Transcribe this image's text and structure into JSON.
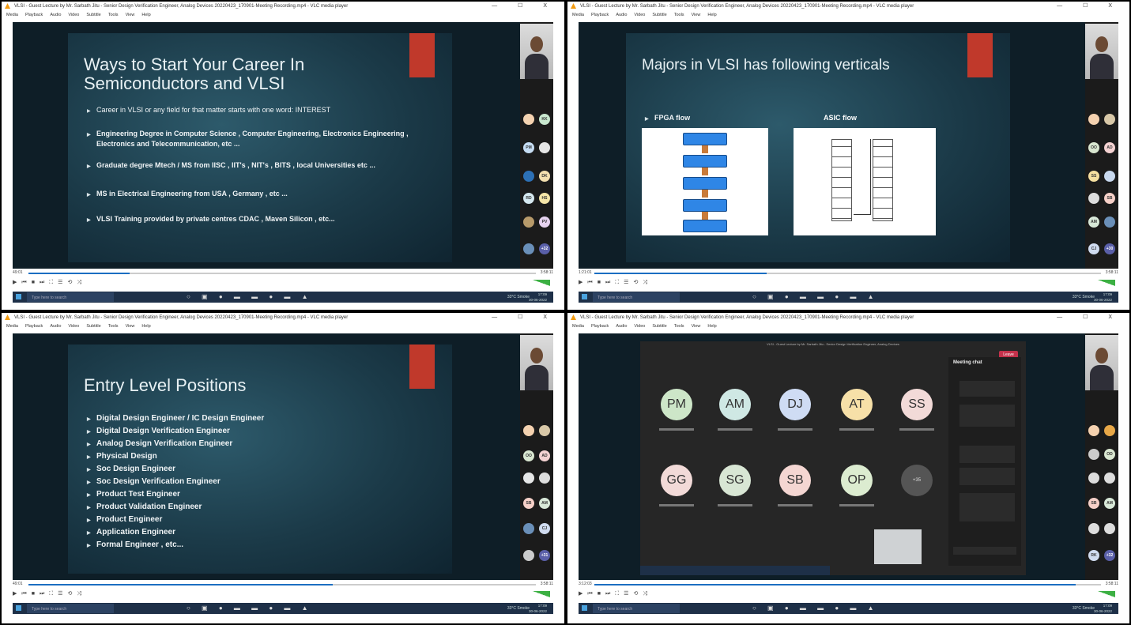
{
  "window": {
    "title": "VLSI - Guest Lecture by Mr. Sarbath Jitu - Senior Design Verification Engineer, Analog Devices 20220423_170901-Meeting Recording.mp4 - VLC media player",
    "meet_title": "VLSI - Guest Lecture by Mr. Sarbath Jitu - Senior Design Verification Engineer, Analog Devices",
    "controls": "—  ☐  X"
  },
  "menu": [
    "Media",
    "Playback",
    "Audio",
    "Video",
    "Subtitle",
    "Tools",
    "View",
    "Help"
  ],
  "taskbar": {
    "search": "Type here to search",
    "weather": "33°C Smoke",
    "time": "17:09",
    "date": "30-06-2022",
    "lang": "ENG"
  },
  "panels": [
    {
      "slide_title": "Ways to Start Your Career In Semiconductors and VLSI",
      "bullets": [
        "Career in VLSI or any field for that matter starts with one word: INTEREST",
        "Engineering Degree in Computer Science , Computer Engineering, Electronics Engineering , Electronics and Telecommunication, etc ...",
        "Graduate degree Mtech / MS from IISC , IIT's , NIT's , BITS , local Universities etc ...",
        "MS in Electrical Engineering from USA , Germany , etc ...",
        "VLSI Training provided by private centres CDAC , Maven Silicon , etc..."
      ],
      "avatars": [
        "",
        "KK",
        "PM",
        "",
        "",
        "DK",
        "RD",
        "HS",
        "",
        "PV",
        "",
        "+32"
      ],
      "time_left": "49:01",
      "time_right": "3:58:11",
      "progress": 0.2
    },
    {
      "slide_title": "Majors in VLSI has following verticals",
      "fpga_label": "FPGA flow",
      "asic_label": "ASIC flow",
      "avatars": [
        "",
        "",
        "OO",
        "AD",
        "SS",
        "",
        "",
        "SB",
        "AM",
        "",
        "CJ",
        "+30"
      ],
      "time_left": "1:21:01",
      "time_right": "3:58:11",
      "progress": 0.34
    },
    {
      "slide_title": "Entry Level Positions",
      "positions": [
        "Digital Design Engineer / IC Design Engineer",
        "Digital Design Verification Engineer",
        "Analog Design Verification Engineer",
        "Physical Design",
        "Soc Design Engineer",
        "Soc Design Verification Engineer",
        "Product Test Engineer",
        "Product Validation Engineer",
        "Product Engineer",
        "Application Engineer",
        "Formal Engineer , etc..."
      ],
      "avatars": [
        "",
        "",
        "OO",
        "AD",
        "",
        "",
        "SB",
        "AM",
        "",
        "CJ",
        "",
        "+31"
      ],
      "time_left": "49:01",
      "time_right": "3:58:11",
      "progress": 0.6
    },
    {
      "participants": [
        "PM",
        "AM",
        "DJ",
        "AT",
        "SS",
        "GG",
        "SG",
        "SB",
        "OP",
        "+35"
      ],
      "chat_title": "Meeting chat",
      "leave_label": "Leave",
      "avatars": [
        "",
        "",
        "",
        "OD",
        "",
        "",
        "SB",
        "AM",
        "",
        "",
        "RK",
        "+32"
      ],
      "time_left": "3:12:03",
      "time_right": "3:58:11",
      "progress": 0.95
    }
  ]
}
